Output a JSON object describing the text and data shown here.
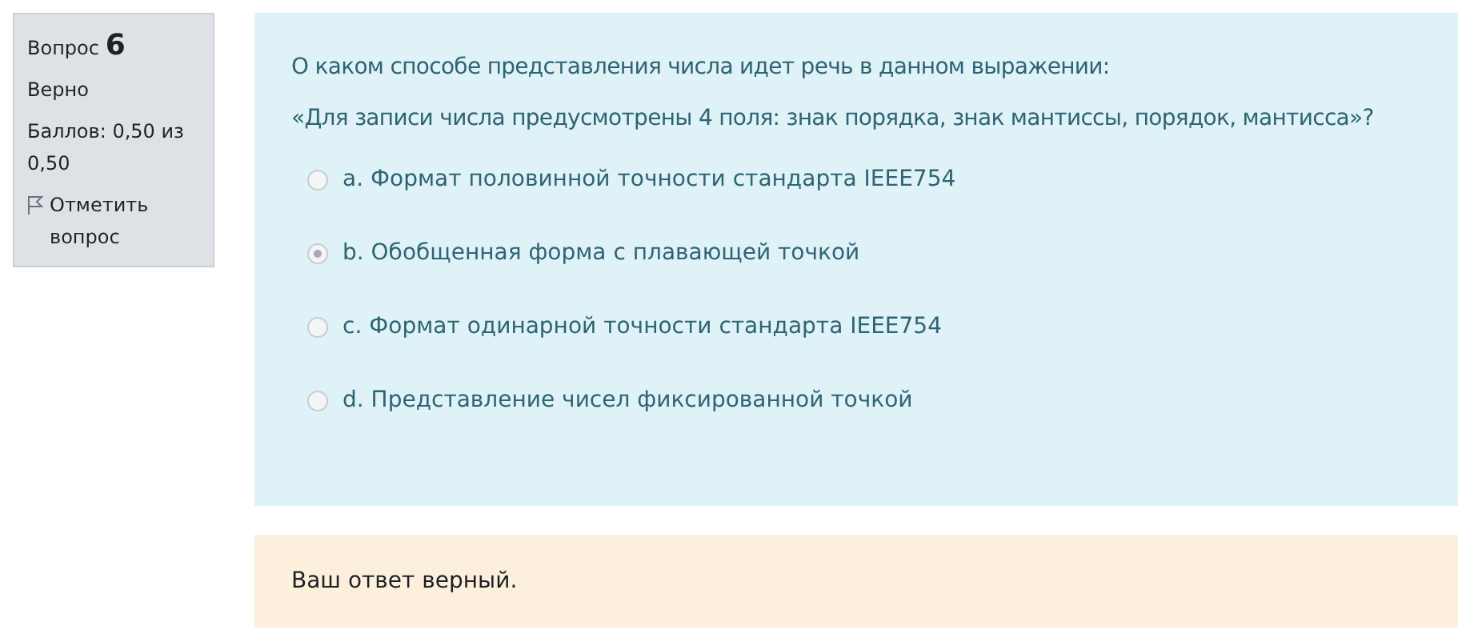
{
  "info": {
    "label": "Вопрос",
    "number": "6",
    "state": "Верно",
    "grade": "Баллов: 0,50 из 0,50",
    "flag": "Отметить вопрос"
  },
  "question": {
    "prompt": "О каком способе представления числа идет речь в данном выражении:",
    "quote": "«Для записи числа предусмотрены 4 поля: знак порядка, знак мантиссы, порядок, мантисса»?",
    "answers": [
      {
        "text": "a. Формат половинной точности стандарта IEEE754",
        "selected": false
      },
      {
        "text": "b. Обобщенная форма с плавающей точкой",
        "selected": true
      },
      {
        "text": "c. Формат одинарной точности стандарта IEEE754",
        "selected": false
      },
      {
        "text": "d. Представление чисел фиксированной точкой",
        "selected": false
      }
    ]
  },
  "feedback": "Ваш ответ верный."
}
